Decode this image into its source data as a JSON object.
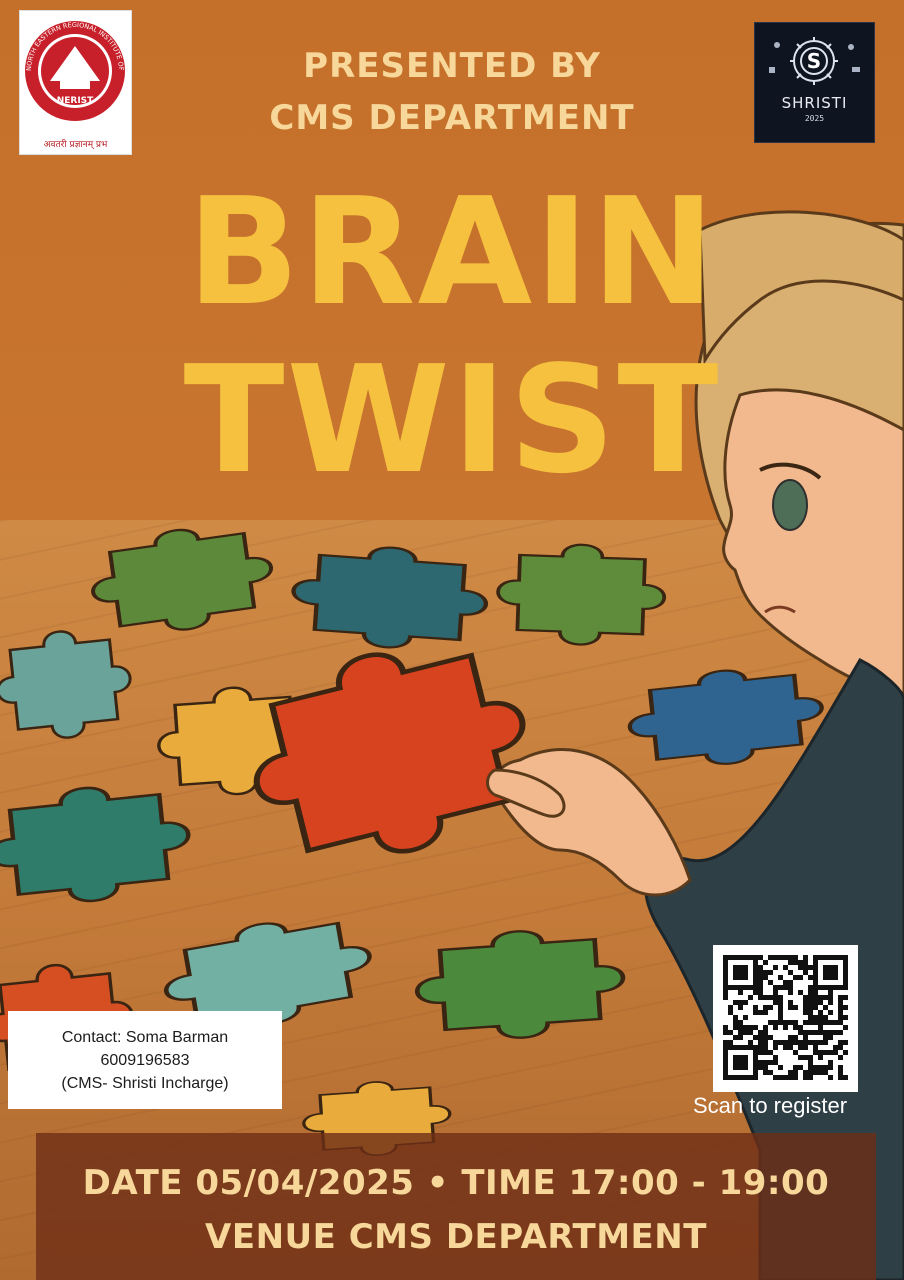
{
  "header": {
    "presented_line1": "PRESENTED BY",
    "presented_line2": "CMS DEPARTMENT"
  },
  "title": {
    "line1": "BRAIN",
    "line2": "TWIST"
  },
  "logos": {
    "left_motto": "अवतरी प्रज्ञानम् प्रभ",
    "left_ring_text": "NORTH EASTERN REGIONAL INSTITUTE OF SCIENCE AND TECHNOLOGY",
    "left_badge_text": "NERIST",
    "right_letter": "S",
    "right_wordmark": "SHRISTI",
    "right_year": "2025"
  },
  "contact": {
    "line1": "Contact: Soma Barman",
    "line2": "6009196583",
    "line3": "(CMS- Shristi Incharge)"
  },
  "qr": {
    "caption": "Scan to register"
  },
  "event": {
    "date_time": "DATE 05/04/2025 • TIME 17:00 - 19:00",
    "venue": "VENUE CMS DEPARTMENT"
  },
  "colors": {
    "background": "#c5702a",
    "title": "#f6c13e",
    "subtitle": "#f7d89a",
    "logo_red": "#c8202a",
    "band": "#6e2e16"
  }
}
